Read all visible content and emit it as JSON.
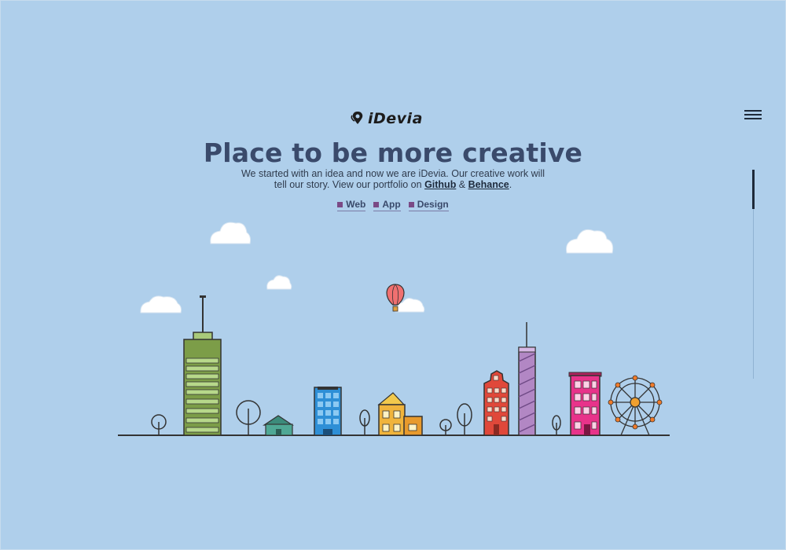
{
  "brand": {
    "name": "iDevia"
  },
  "hero": {
    "title": "Place to be more creative",
    "desc_text": "We started with an idea and now we are iDevia. Our creative work will tell our story. View our portfolio on ",
    "github_label": "Github",
    "amp": " & ",
    "behance_label": "Behance",
    "period": "."
  },
  "tags": [
    {
      "label": "Web"
    },
    {
      "label": "App"
    },
    {
      "label": "Design"
    }
  ],
  "icons": {
    "menu": "hamburger-menu-icon",
    "logo": "location-pin-icon"
  },
  "colors": {
    "background": "#afcfeb",
    "title": "#3a4a6b",
    "tag_square": "#7a4a86"
  }
}
